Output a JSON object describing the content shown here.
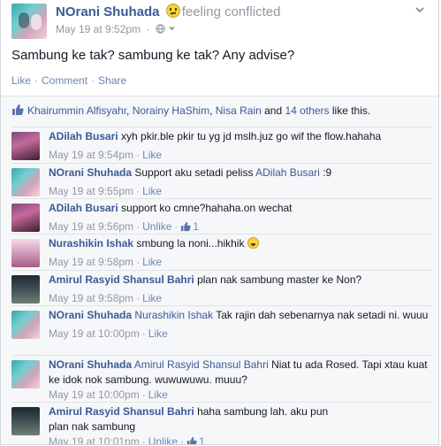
{
  "post": {
    "author": "NOrani Shuhada",
    "feeling": "feeling conflicted",
    "timestamp": "May 19 at 9:52pm",
    "separator": "·",
    "privacy_icon": "globe-icon",
    "text": "Sambung ke tak? sambung ke tak? Any advise?",
    "actions": [
      "Like",
      "Comment",
      "Share"
    ]
  },
  "likes": {
    "names": [
      "Khairummin Alfisyahr",
      "Norainy HaShim",
      "Nisa Rain"
    ],
    "separators": [
      ", ",
      ", ",
      " and "
    ],
    "others": "14 others",
    "suffix": " like this."
  },
  "comments": [
    {
      "name": "ADilah Busari",
      "tag": "",
      "text": "xyh pkir.ble pkir tu yg jd mslh.juz go wif the flow.hahaha",
      "time": "May 19 at 9:54pm",
      "action": "Like",
      "likes": ""
    },
    {
      "name": "NOrani Shuhada",
      "tag": "",
      "text": "Support aku setadi peliss ",
      "tag2": "ADilah Busari",
      "text2": " :9",
      "time": "May 19 at 9:55pm",
      "action": "Like",
      "likes": ""
    },
    {
      "name": "ADilah Busari",
      "tag": "",
      "text": "support ko cmne?hahaha.on wechat",
      "time": "May 19 at 9:56pm",
      "action": "Unlike",
      "likes": "1"
    },
    {
      "name": "Nurashikin Ishak",
      "tag": "",
      "text": "smbung la noni...hikhik ",
      "time": "May 19 at 9:58pm",
      "action": "Like",
      "likes": ""
    },
    {
      "name": "Amirul Rasyid Shansul Bahri",
      "tag": "",
      "text": "plan nak sambung master ke Non?",
      "time": "May 19 at 9:58pm",
      "action": "Like",
      "likes": ""
    },
    {
      "name": "NOrani Shuhada",
      "tag": "Nurashikin Ishak",
      "text": " Tak rajin dah sebenarnya nak setadi ni. wuuu",
      "time": "May 19 at 10:00pm",
      "action": "Like",
      "likes": ""
    },
    {
      "name": "NOrani Shuhada",
      "tag": "Amirul Rasyid Shansul Bahri",
      "text": " Niat tu ada Rosed. Tapi xtau kuat ke idok nok sambung. wuwuwuwu. muuu?",
      "time": "May 19 at 10:00pm",
      "action": "Like",
      "likes": ""
    },
    {
      "name": "Amirul Rasyid Shansul Bahri",
      "tag": "",
      "text": "haha sambung lah. aku pun plan nak sambung",
      "time": "May 19 at 10:01pm",
      "action": "Unlike",
      "likes": "1"
    }
  ],
  "dot": "·",
  "colors": {
    "link": "#3b5998",
    "meta": "#9197a3",
    "ufi_bg": "#f6f7f9"
  }
}
